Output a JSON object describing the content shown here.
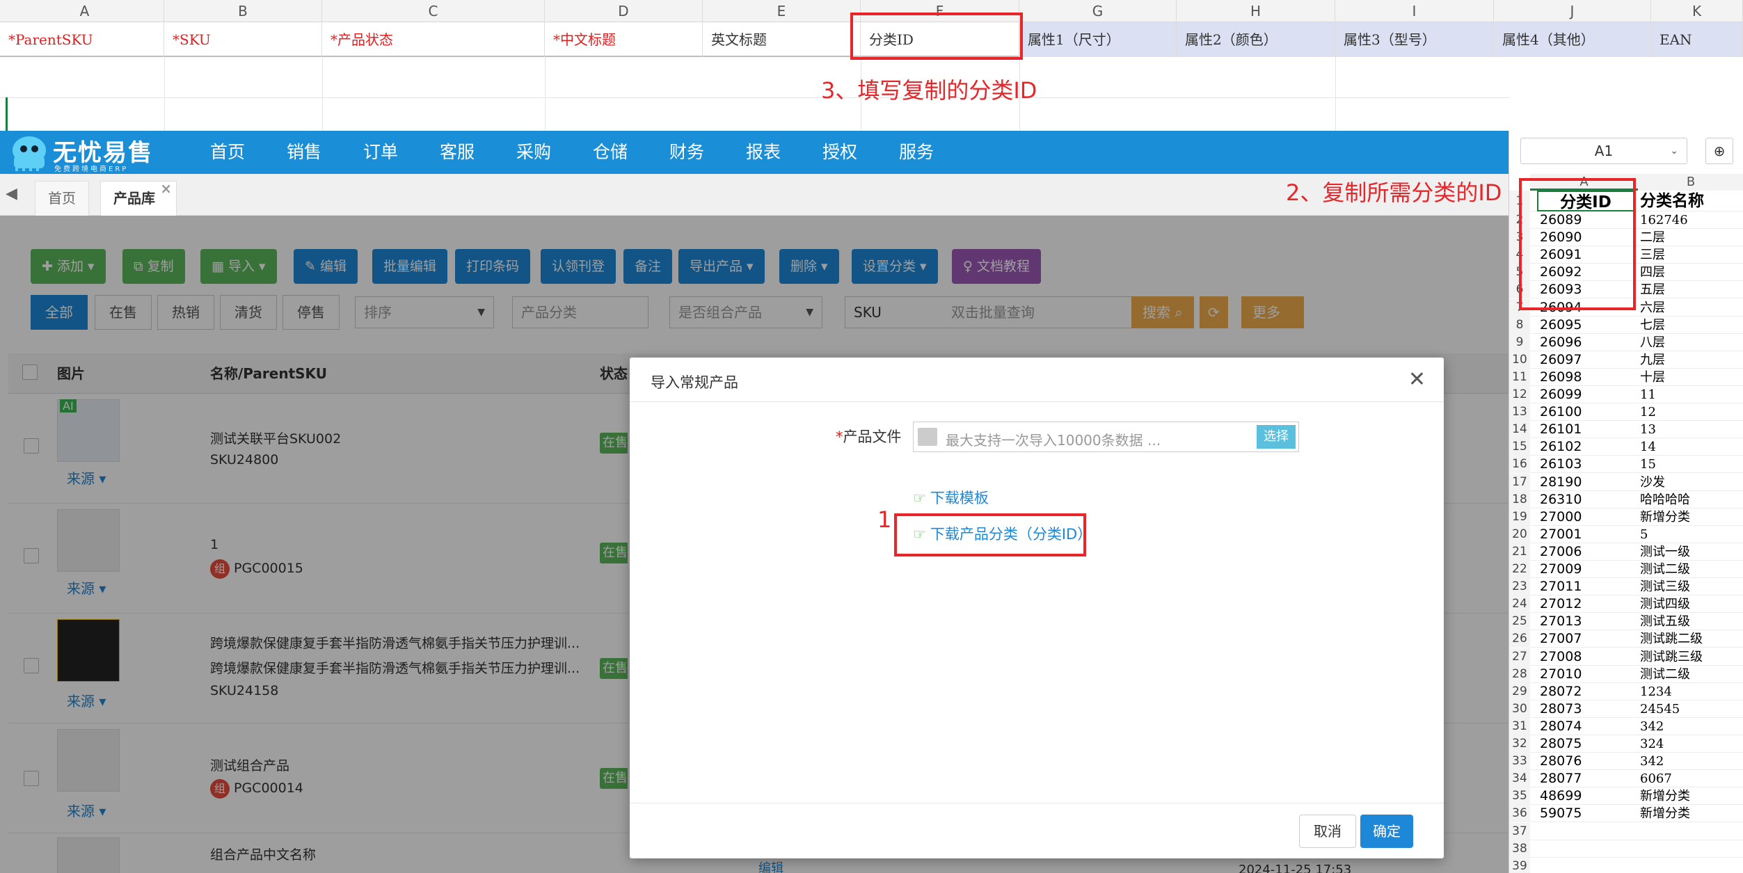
{
  "sheet": {
    "columns": [
      "A",
      "B",
      "C",
      "D",
      "E",
      "F",
      "G",
      "H",
      "I",
      "J",
      "K"
    ],
    "fields": [
      "*ParentSKU",
      "*SKU",
      "*产品状态",
      "*中文标题",
      "英文标题",
      "分类ID",
      "属性1（尺寸）",
      "属性2（颜色）",
      "属性3（型号）",
      "属性4（其他）",
      "EAN"
    ]
  },
  "annotations": {
    "step3": "3、填写复制的分类ID",
    "step2": "2、复制所需分类的ID",
    "step1": "1"
  },
  "app": {
    "logo_title": "无忧易售",
    "logo_sub": "免费跨境电商ERP",
    "nav": [
      "首页",
      "销售",
      "订单",
      "客服",
      "采购",
      "仓储",
      "财务",
      "报表",
      "授权",
      "服务"
    ],
    "tabs": [
      "首页",
      "产品库"
    ],
    "toolbar": [
      "添加",
      "复制",
      "导入",
      "编辑",
      "批量编辑",
      "打印条码",
      "认领刊登",
      "备注",
      "导出产品",
      "删除",
      "设置分类",
      "文档教程"
    ],
    "filters": [
      "全部",
      "在售",
      "热销",
      "清货",
      "停售"
    ],
    "sort_placeholder": "排序",
    "category_placeholder": "产品分类",
    "combo_placeholder": "是否组合产品",
    "sku_select": "SKU",
    "batch_query_placeholder": "双击批量查询",
    "search": "搜索",
    "more": "更多",
    "table_headers": [
      "图片",
      "名称/ParentSKU",
      "状态"
    ],
    "rows": [
      {
        "line1": "测试关联平台SKU002",
        "line2": "SKU24800",
        "source": "来源",
        "status": "在售",
        "ai": "AI"
      },
      {
        "line1": "1",
        "line2": "PGC00015",
        "source": "来源",
        "status": "在售",
        "combo": "组"
      },
      {
        "line1": "跨境爆款保健康复手套半指防滑透气棉氨手指关节压力护理训...",
        "line2": "跨境爆款保健康复手套半指防滑透气棉氨手指关节压力护理训...",
        "line3": "SKU24158",
        "source": "来源",
        "status": "在售"
      },
      {
        "line1": "测试组合产品",
        "line2": "PGC00014",
        "source": "来源",
        "status": "在售",
        "combo": "组"
      },
      {
        "line1": "组合产品中文名称",
        "edit": "编辑",
        "time": "2024-11-25 17:53"
      }
    ]
  },
  "modal": {
    "title": "导入常规产品",
    "file_label": "产品文件",
    "file_placeholder": "最大支持一次导入10000条数据 ...",
    "select_btn": "选择",
    "download_template": "下载模板",
    "download_category": "下载产品分类（分类ID）",
    "cancel": "取消",
    "confirm": "确定"
  },
  "category_sheet": {
    "cell_ref": "A1",
    "col_a": "A",
    "col_b": "B",
    "header_id": "分类ID",
    "header_name": "分类名称",
    "rows": [
      [
        "26089",
        "162746"
      ],
      [
        "26090",
        "二层"
      ],
      [
        "26091",
        "三层"
      ],
      [
        "26092",
        "四层"
      ],
      [
        "26093",
        "五层"
      ],
      [
        "26094",
        "六层"
      ],
      [
        "26095",
        "七层"
      ],
      [
        "26096",
        "八层"
      ],
      [
        "26097",
        "九层"
      ],
      [
        "26098",
        "十层"
      ],
      [
        "26099",
        "11"
      ],
      [
        "26100",
        "12"
      ],
      [
        "26101",
        "13"
      ],
      [
        "26102",
        "14"
      ],
      [
        "26103",
        "15"
      ],
      [
        "28190",
        "沙发"
      ],
      [
        "26310",
        "哈哈哈哈"
      ],
      [
        "27000",
        "新增分类"
      ],
      [
        "27001",
        "5"
      ],
      [
        "27006",
        "测试一级"
      ],
      [
        "27009",
        "测试二级"
      ],
      [
        "27011",
        "测试三级"
      ],
      [
        "27012",
        "测试四级"
      ],
      [
        "27013",
        "测试五级"
      ],
      [
        "27007",
        "测试跳二级"
      ],
      [
        "27008",
        "测试跳三级"
      ],
      [
        "27010",
        "测试二级"
      ],
      [
        "28072",
        "1234"
      ],
      [
        "28073",
        "24545"
      ],
      [
        "28074",
        "342"
      ],
      [
        "28075",
        "324"
      ],
      [
        "28076",
        "342"
      ],
      [
        "28077",
        "6067"
      ],
      [
        "48699",
        "新增分类"
      ],
      [
        "59075",
        "新增分类"
      ],
      [
        "",
        ""
      ],
      [
        "",
        ""
      ],
      [
        "",
        ""
      ]
    ]
  },
  "colors": {
    "nav_blue": "#1a8fd8",
    "annotation_red": "#e8262a",
    "required_red": "#e02020",
    "attr_fill": "#dbe1f3"
  }
}
